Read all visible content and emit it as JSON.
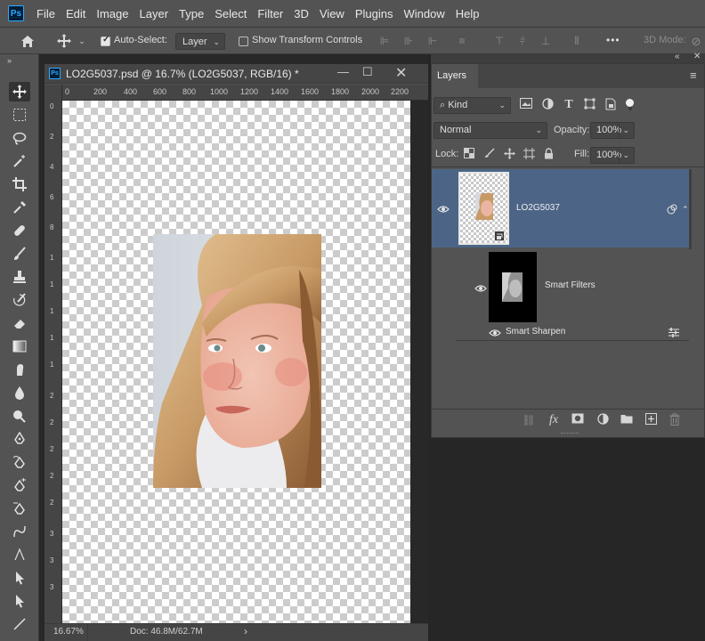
{
  "app": {
    "logo_text": "Ps",
    "menu": [
      "File",
      "Edit",
      "Image",
      "Layer",
      "Type",
      "Select",
      "Filter",
      "3D",
      "View",
      "Plugins",
      "Window",
      "Help"
    ]
  },
  "options_bar": {
    "auto_select_label": "Auto-Select:",
    "auto_select_checked": true,
    "auto_select_target": "Layer",
    "show_transform_label": "Show Transform Controls",
    "show_transform_checked": false,
    "more_label": "•••",
    "mode_3d_label": "3D Mode:"
  },
  "document": {
    "tab_title": "LO2G5037.psd @ 16.7% (LO2G5037, RGB/16) *",
    "ruler_top": [
      "0",
      "200",
      "400",
      "600",
      "800",
      "1000",
      "1200",
      "1400",
      "1600",
      "1800",
      "2000",
      "2200"
    ],
    "ruler_left": [
      "0",
      "2",
      "4",
      "6",
      "8",
      "1",
      "1",
      "1",
      "1",
      "1",
      "2",
      "2",
      "2",
      "2",
      "2",
      "3",
      "3",
      "3",
      "3",
      "3"
    ],
    "zoom": "16.67%",
    "doc_info": "Doc: 46.8M/62.7M"
  },
  "layers_panel": {
    "tab_label": "Layers",
    "filter_kind": "Kind",
    "blend_mode": "Normal",
    "opacity_label": "Opacity:",
    "opacity_value": "100%",
    "lock_label": "Lock:",
    "fill_label": "Fill:",
    "fill_value": "100%",
    "layers": [
      {
        "name": "LO2G5037",
        "selected": true,
        "visible": true
      },
      {
        "name": "Smart Filters",
        "visible": true
      },
      {
        "name": "Smart Sharpen",
        "visible": true
      }
    ],
    "accent_color": "#4c6586"
  },
  "colors": {
    "ui_bg": "#535353",
    "dark_bg": "#282828",
    "ps_blue": "#31a8ff"
  }
}
